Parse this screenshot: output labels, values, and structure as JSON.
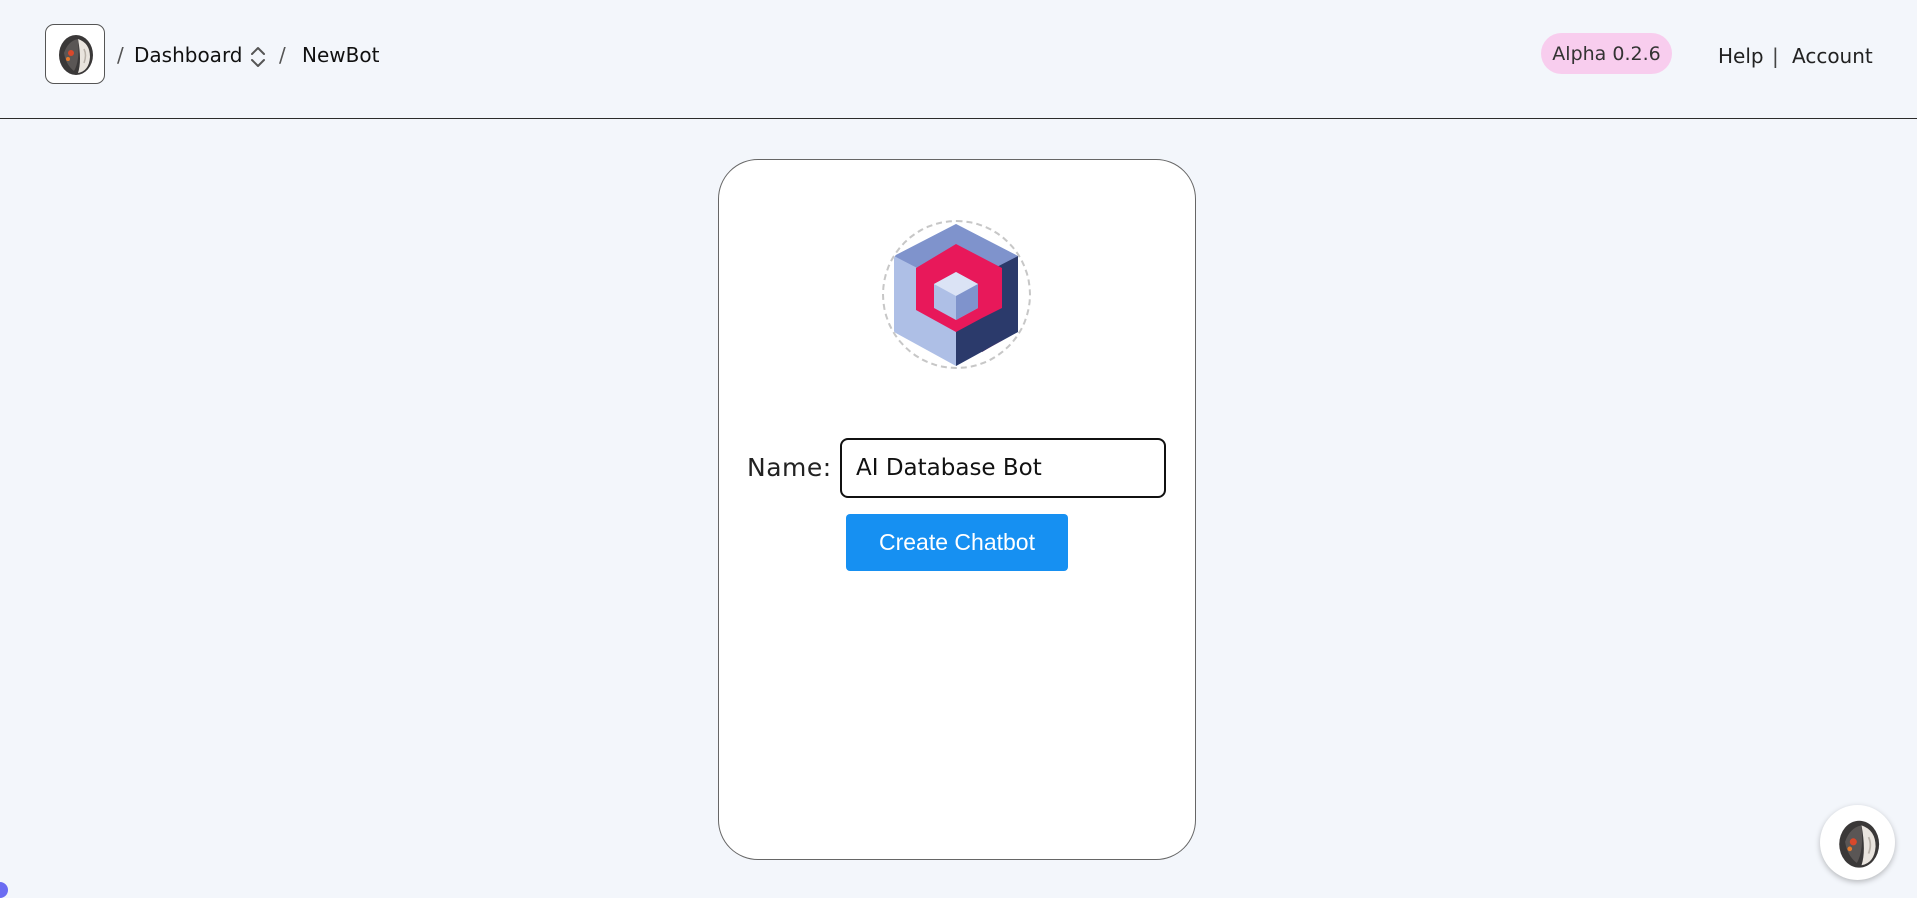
{
  "header": {
    "breadcrumb": {
      "separator": "/",
      "dashboard": "Dashboard",
      "current": "NewBot"
    },
    "version_badge": "Alpha 0.2.6",
    "links": {
      "help": "Help",
      "divider": "|",
      "account": "Account"
    }
  },
  "form": {
    "name_label": "Name:",
    "name_value": "AI Database Bot",
    "submit_label": "Create Chatbot"
  },
  "icons": {
    "app_logo": "robot-head-icon",
    "breadcrumb_switcher": "chevron-up-down-icon",
    "bot_avatar": "cube-logo-icon",
    "chat_launcher": "robot-head-icon"
  },
  "colors": {
    "background": "#f3f6fb",
    "badge_bg": "#f8cdee",
    "primary_button": "#1690f2",
    "avatar_red": "#e8185a",
    "avatar_navy": "#2b3a6b",
    "avatar_light": "#aebfe6"
  }
}
